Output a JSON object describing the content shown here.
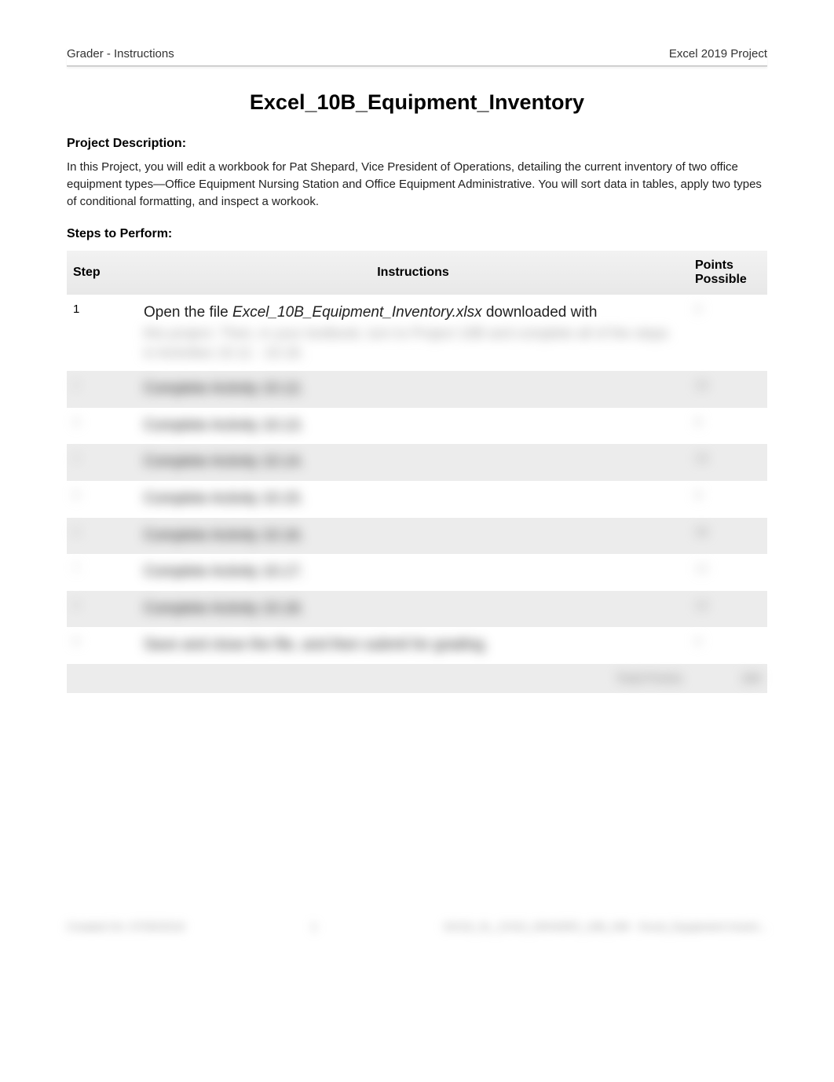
{
  "header": {
    "left": "Grader - Instructions",
    "right": "Excel 2019 Project"
  },
  "title": "Excel_10B_Equipment_Inventory",
  "project_description_label": "Project Description:",
  "project_description_text": "In this Project, you will edit a workbook for Pat Shepard, Vice President of Operations, detailing the current inventory of two office equipment types—Office Equipment Nursing Station and Office Equipment Administrative. You will sort data in tables, apply two types of conditional formatting, and inspect a workook.",
  "steps_label": "Steps to Perform:",
  "table": {
    "headers": {
      "step": "Step",
      "instructions": "Instructions",
      "points": "Points Possible"
    },
    "rows": [
      {
        "step": "1",
        "instruction_prefix": "Open the file ",
        "instruction_file": "Excel_10B_Equipment_Inventory.xlsx",
        "instruction_suffix": " downloaded with",
        "instruction_blur": "this project. Then, in your textbook, turn to Project 10B and complete all of the steps in Activities 10.11 - 10.18.",
        "points": "0"
      },
      {
        "step": "2",
        "instruction_blur": "Complete Activity 10.12.",
        "points": "15"
      },
      {
        "step": "3",
        "instruction_blur": "Complete Activity 10.13.",
        "points": "8"
      },
      {
        "step": "4",
        "instruction_blur": "Complete Activity 10.14.",
        "points": "15"
      },
      {
        "step": "5",
        "instruction_blur": "Complete Activity 10.15.",
        "points": "8"
      },
      {
        "step": "6",
        "instruction_blur": "Complete Activity 10.16.",
        "points": "30"
      },
      {
        "step": "7",
        "instruction_blur": "Complete Activity 10.17.",
        "points": "12"
      },
      {
        "step": "8",
        "instruction_blur": "Complete Activity 10.18.",
        "points": "12"
      },
      {
        "step": "9",
        "instruction_blur": "Save and close the file, and then submit for grading.",
        "points": "0"
      }
    ],
    "total_label": "Total Points",
    "total_value": "100"
  },
  "footer": {
    "left": "Created On: 07/05/2019",
    "center": "1",
    "right": "GO19_XL_CH10_GRADER_10B_HW - Excel_Equipment Invent..."
  }
}
